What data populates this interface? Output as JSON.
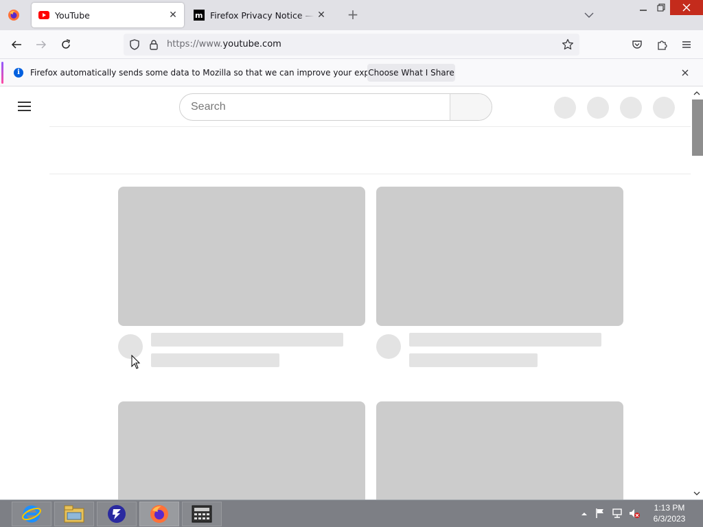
{
  "browser": {
    "tabs": [
      {
        "title": "YouTube",
        "active": true,
        "favicon": "youtube-icon"
      },
      {
        "title": "Firefox Privacy Notice — Mozill",
        "active": false,
        "favicon": "mozilla-icon"
      }
    ],
    "url": {
      "prefix": "https://www.",
      "domain": "youtube.com"
    },
    "notification": {
      "message": "Firefox automatically sends some data to Mozilla so that we can improve your experience.",
      "button": "Choose What I Share"
    }
  },
  "page": {
    "search_placeholder": "Search"
  },
  "taskbar": {
    "apps": [
      "internet-explorer-icon",
      "file-explorer-icon",
      "filezilla-icon",
      "firefox-icon",
      "calculator-icon"
    ],
    "time": "1:13 PM",
    "date": "6/3/2023"
  },
  "colors": {
    "accent": "#0060df",
    "youtube_red": "#ff0000",
    "skeleton": "#cccccc",
    "close_red": "#c42b1c"
  }
}
